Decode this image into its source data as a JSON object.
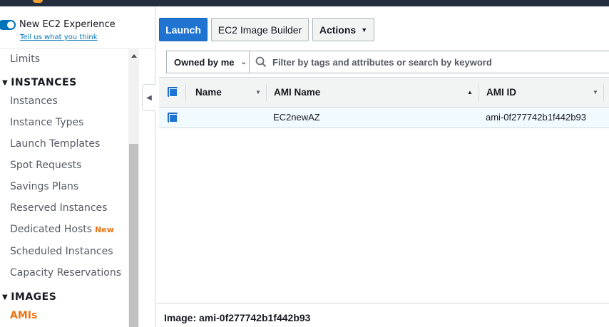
{
  "sidebar": {
    "experience_toggle_label": "New EC2 Experience",
    "feedback_link": "Tell us what you think",
    "items": [
      {
        "label": "Limits"
      },
      {
        "section": "INSTANCES"
      },
      {
        "label": "Instances"
      },
      {
        "label": "Instance Types"
      },
      {
        "label": "Launch Templates"
      },
      {
        "label": "Spot Requests"
      },
      {
        "label": "Savings Plans"
      },
      {
        "label": "Reserved Instances"
      },
      {
        "label": "Dedicated Hosts",
        "badge": "New"
      },
      {
        "label": "Scheduled Instances"
      },
      {
        "label": "Capacity Reservations"
      },
      {
        "section": "IMAGES"
      },
      {
        "label": "AMIs",
        "active": true
      }
    ]
  },
  "toolbar": {
    "launch_label": "Launch",
    "image_builder_label": "EC2 Image Builder",
    "actions_label": "Actions"
  },
  "filter": {
    "owner_selected": "Owned by me",
    "search_placeholder": "Filter by tags and attributes or search by keyword"
  },
  "table": {
    "columns": [
      "Name",
      "AMI Name",
      "AMI ID"
    ],
    "rows": [
      {
        "name": "",
        "ami_name": "EC2newAZ",
        "ami_id": "ami-0f277742b1f442b93",
        "selected": true
      }
    ]
  },
  "details": {
    "title": "Image: ami-0f277742b1f442b93"
  },
  "colors": {
    "primary": "#1f73d1",
    "active_nav": "#ec7211",
    "header_bar": "#232f3e"
  }
}
